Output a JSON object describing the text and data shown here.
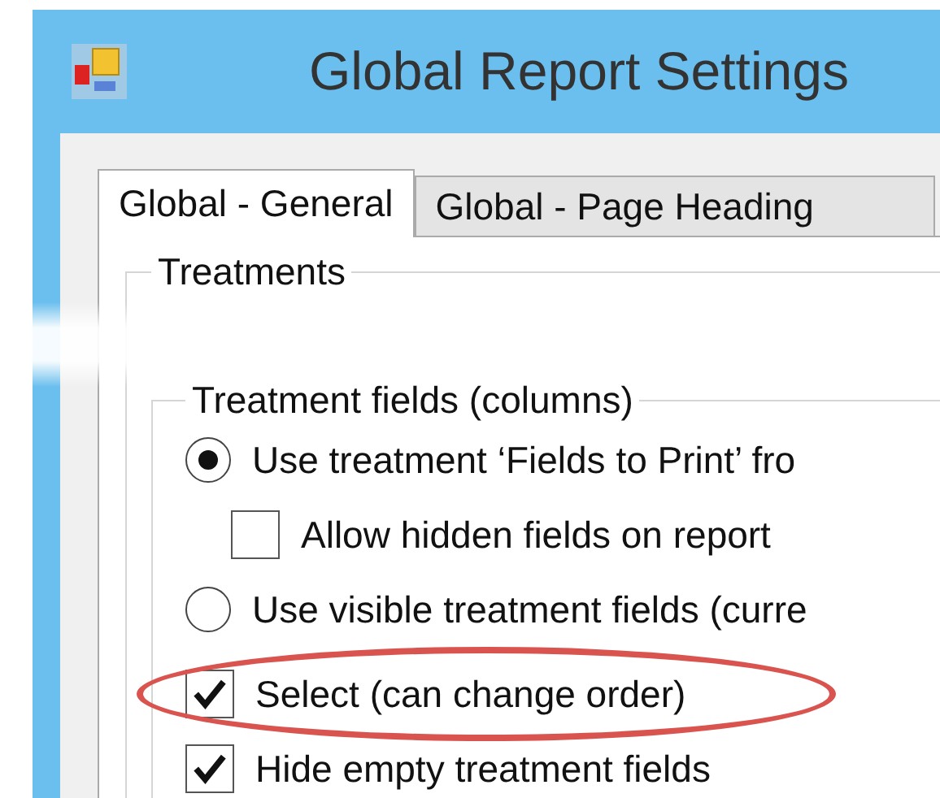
{
  "window": {
    "title": "Global Report Settings"
  },
  "tabs": [
    {
      "label": "Global - General",
      "selected": true
    },
    {
      "label": "Global - Page Heading",
      "selected": false
    }
  ],
  "treatments_group": {
    "title": "Treatments"
  },
  "fields_group": {
    "title": "Treatment fields (columns)",
    "options": [
      {
        "kind": "radio",
        "label": "Use treatment ‘Fields to Print’ fro",
        "checked": true,
        "highlighted": false,
        "children": [
          {
            "kind": "checkbox",
            "label": "Allow hidden fields on report",
            "checked": false,
            "highlighted": false
          }
        ]
      },
      {
        "kind": "radio",
        "label": "Use visible treatment fields (curre",
        "checked": false,
        "highlighted": false
      },
      {
        "kind": "checkbox",
        "label": "Select (can change order)",
        "checked": true,
        "highlighted": true
      },
      {
        "kind": "checkbox",
        "label": "Hide empty treatment fields",
        "checked": true,
        "highlighted": false
      }
    ]
  }
}
